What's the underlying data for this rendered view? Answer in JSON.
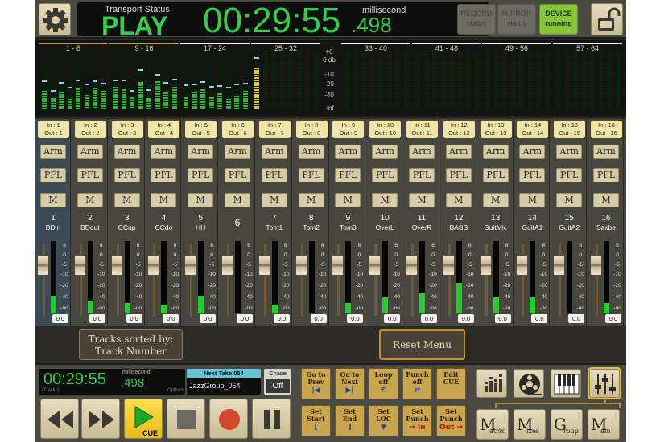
{
  "topbar": {
    "transport_status_label": "Transport Status",
    "transport_state": "PLAY",
    "time_main": "00:29:55",
    "time_ms": ".498",
    "ms_label": "millisecond",
    "record": {
      "label": "RECORD",
      "status": "status"
    },
    "mirror": {
      "label": "MIRROR",
      "status": "status"
    },
    "device": {
      "label": "DEVICE",
      "status": "running"
    }
  },
  "meters": {
    "groups": [
      "1 - 8",
      "9 - 16",
      "17 - 24",
      "25 - 32",
      "33 - 40",
      "41 - 48",
      "49 - 56",
      "57 - 64"
    ],
    "db_scale": [
      "+6",
      "0 db",
      "-10",
      "-20",
      "-40",
      "-inf"
    ]
  },
  "channels": [
    {
      "io_in": "In : 1",
      "io_out": "Out : 1",
      "num": "1",
      "name": "BDin",
      "fader": 0.78,
      "level": 0.25,
      "value": "0.0"
    },
    {
      "io_in": "In : 2",
      "io_out": "Out : 2",
      "num": "2",
      "name": "BDout",
      "fader": 0.78,
      "level": 0.18,
      "value": "0.0"
    },
    {
      "io_in": "In : 3",
      "io_out": "Out : 3",
      "num": "3",
      "name": "CCup",
      "fader": 0.78,
      "level": 0.15,
      "value": "0.0"
    },
    {
      "io_in": "In : 4",
      "io_out": "Out : 4",
      "num": "4",
      "name": "CCdo",
      "fader": 0.78,
      "level": 0.12,
      "value": "0.0"
    },
    {
      "io_in": "In : 5",
      "io_out": "Out : 5",
      "num": "5",
      "name": "HH",
      "fader": 0.78,
      "level": 0.25,
      "value": "0.0"
    },
    {
      "io_in": "In : 6",
      "io_out": "Out : 6",
      "num": "6",
      "name": "",
      "fader": 0.78,
      "level": 0.0,
      "value": "0.0"
    },
    {
      "io_in": "In : 7",
      "io_out": "Out : 7",
      "num": "7",
      "name": "Tom1",
      "fader": 0.78,
      "level": 0.12,
      "value": "0.0"
    },
    {
      "io_in": "In : 8",
      "io_out": "Out : 8",
      "num": "8",
      "name": "Tom2",
      "fader": 0.78,
      "level": 0.0,
      "value": "0.0"
    },
    {
      "io_in": "In : 9",
      "io_out": "Out : 9",
      "num": "9",
      "name": "Tom3",
      "fader": 0.78,
      "level": 0.15,
      "value": "0.0"
    },
    {
      "io_in": "In : 10",
      "io_out": "Out : 10",
      "num": "10",
      "name": "OverL",
      "fader": 0.78,
      "level": 0.22,
      "value": "0.0"
    },
    {
      "io_in": "In : 11",
      "io_out": "Out : 11",
      "num": "11",
      "name": "OverR",
      "fader": 0.78,
      "level": 0.28,
      "value": "0.0"
    },
    {
      "io_in": "In : 12",
      "io_out": "Out : 12",
      "num": "12",
      "name": "BASS",
      "fader": 0.78,
      "level": 0.42,
      "value": "0.0"
    },
    {
      "io_in": "In : 13",
      "io_out": "Out : 13",
      "num": "13",
      "name": "GuitMic",
      "fader": 0.78,
      "level": 0.22,
      "value": "0.0"
    },
    {
      "io_in": "In : 14",
      "io_out": "Out : 14",
      "num": "14",
      "name": "GuitA1",
      "fader": 0.78,
      "level": 0.22,
      "value": "0.0"
    },
    {
      "io_in": "In : 15",
      "io_out": "Out : 15",
      "num": "15",
      "name": "GuitA2",
      "fader": 0.78,
      "level": 0.0,
      "value": "0.0"
    },
    {
      "io_in": "In : 16",
      "io_out": "Out : 16",
      "num": "16",
      "name": "Saxbe",
      "fader": 0.78,
      "level": 0.15,
      "value": "0.0"
    }
  ],
  "strip_buttons": {
    "arm": "Arm",
    "pfl": "PFL",
    "mute": "M"
  },
  "fader_scale": [
    "6",
    "0",
    "-5",
    "-10",
    "-20",
    "-40",
    "-oo"
  ],
  "midbar": {
    "sort_line1": "Tracks sorted by:",
    "sort_line2": "Track Number",
    "reset": "Reset Menu"
  },
  "bottom": {
    "time_main": "00:29:55",
    "time_ms": ".498",
    "ms_label": "millisecond",
    "tc_label": "(Tracks)",
    "opt_label": "Options",
    "next_take_label": "Next Take 054",
    "next_take_value": "JazzGroup_054",
    "chase_label": "Chase",
    "chase_value": "Off",
    "cue_label": "CUE"
  },
  "locate_buttons": [
    {
      "l1": "Go to",
      "l2": "Prev",
      "icon": "|◀"
    },
    {
      "l1": "Go to",
      "l2": "Next",
      "icon": "▶|"
    },
    {
      "l1": "Loop",
      "l2": "off",
      "icon": "⟲"
    },
    {
      "l1": "Punch",
      "l2": "off",
      "icon": "⇄"
    },
    {
      "l1": "Edit",
      "l2": "CUE",
      "icon": ""
    },
    {
      "l1": "Set",
      "l2": "Start",
      "icon": "["
    },
    {
      "l1": "Set",
      "l2": "End",
      "icon": "]"
    },
    {
      "l1": "Set",
      "l2": "LOC",
      "icon": "▼"
    },
    {
      "l1": "Set",
      "l2": "Punch",
      "icon": "→ In"
    },
    {
      "l1": "Set",
      "l2": "Punch",
      "icon": "Out →"
    }
  ],
  "mix_buttons": [
    {
      "big": "M",
      "small": "atrix"
    },
    {
      "big": "M",
      "small": "ixes"
    },
    {
      "big": "G",
      "small": "roup"
    },
    {
      "big": "M",
      "small": "ain"
    }
  ],
  "colors": {
    "display_green": "#2ecf4a",
    "device_on": "#86c43b",
    "accent_gold": "#c3942a"
  }
}
